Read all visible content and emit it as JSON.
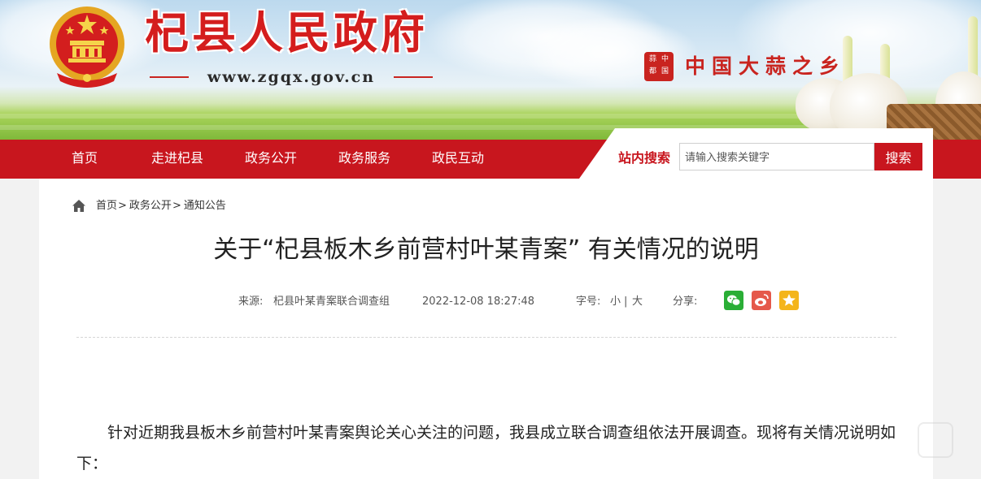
{
  "header": {
    "site_title": "杞县人民政府",
    "site_url": "www.zgqx.gov.cn",
    "slogan": "中国大蒜之乡",
    "seal_chars": [
      "蒜",
      "中",
      "都",
      "国"
    ]
  },
  "nav": {
    "items": [
      "首页",
      "走进杞县",
      "政务公开",
      "政务服务",
      "政民互动"
    ],
    "search_label": "站内搜索",
    "search_placeholder": "请输入搜索关键字",
    "search_button": "搜索"
  },
  "breadcrumb": {
    "items": [
      "首页",
      "政务公开",
      "通知公告"
    ],
    "separator": ">"
  },
  "article": {
    "title": "关于“杞县板木乡前营村叶某青案” 有关情况的说明",
    "source_label": "来源:",
    "source": "杞县叶某青案联合调查组",
    "datetime": "2022-12-08 18:27:48",
    "font_size_label": "字号:",
    "font_small": "小",
    "font_sep": "|",
    "font_large": "大",
    "share_label": "分享:",
    "share_icons": [
      "wechat-icon",
      "weibo-icon",
      "qzone-icon"
    ],
    "paragraph": "针对近期我县板木乡前营村叶某青案舆论关心关注的问题，我县成立联合调查组依法开展调查。现将有关情况说明如下："
  },
  "colors": {
    "brand_red": "#c8161e",
    "title_red": "#d41d1d",
    "wechat_green": "#2aae36",
    "weibo_red": "#e5594b",
    "qzone_yellow": "#f4b51b"
  }
}
